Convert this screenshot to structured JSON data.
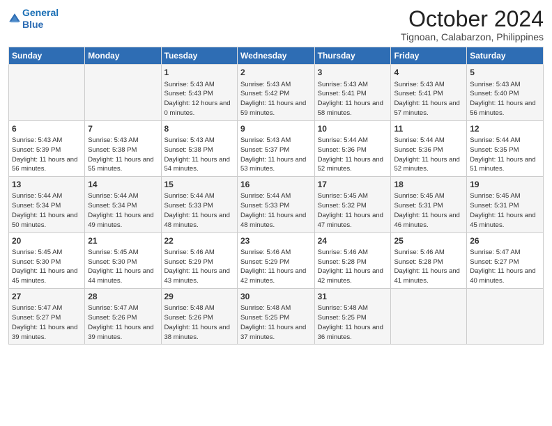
{
  "logo": {
    "line1": "General",
    "line2": "Blue"
  },
  "title": "October 2024",
  "location": "Tignoan, Calabarzon, Philippines",
  "days_of_week": [
    "Sunday",
    "Monday",
    "Tuesday",
    "Wednesday",
    "Thursday",
    "Friday",
    "Saturday"
  ],
  "weeks": [
    [
      {
        "day": "",
        "sunrise": "",
        "sunset": "",
        "daylight": ""
      },
      {
        "day": "",
        "sunrise": "",
        "sunset": "",
        "daylight": ""
      },
      {
        "day": "1",
        "sunrise": "Sunrise: 5:43 AM",
        "sunset": "Sunset: 5:43 PM",
        "daylight": "Daylight: 12 hours and 0 minutes."
      },
      {
        "day": "2",
        "sunrise": "Sunrise: 5:43 AM",
        "sunset": "Sunset: 5:42 PM",
        "daylight": "Daylight: 11 hours and 59 minutes."
      },
      {
        "day": "3",
        "sunrise": "Sunrise: 5:43 AM",
        "sunset": "Sunset: 5:41 PM",
        "daylight": "Daylight: 11 hours and 58 minutes."
      },
      {
        "day": "4",
        "sunrise": "Sunrise: 5:43 AM",
        "sunset": "Sunset: 5:41 PM",
        "daylight": "Daylight: 11 hours and 57 minutes."
      },
      {
        "day": "5",
        "sunrise": "Sunrise: 5:43 AM",
        "sunset": "Sunset: 5:40 PM",
        "daylight": "Daylight: 11 hours and 56 minutes."
      }
    ],
    [
      {
        "day": "6",
        "sunrise": "Sunrise: 5:43 AM",
        "sunset": "Sunset: 5:39 PM",
        "daylight": "Daylight: 11 hours and 56 minutes."
      },
      {
        "day": "7",
        "sunrise": "Sunrise: 5:43 AM",
        "sunset": "Sunset: 5:38 PM",
        "daylight": "Daylight: 11 hours and 55 minutes."
      },
      {
        "day": "8",
        "sunrise": "Sunrise: 5:43 AM",
        "sunset": "Sunset: 5:38 PM",
        "daylight": "Daylight: 11 hours and 54 minutes."
      },
      {
        "day": "9",
        "sunrise": "Sunrise: 5:43 AM",
        "sunset": "Sunset: 5:37 PM",
        "daylight": "Daylight: 11 hours and 53 minutes."
      },
      {
        "day": "10",
        "sunrise": "Sunrise: 5:44 AM",
        "sunset": "Sunset: 5:36 PM",
        "daylight": "Daylight: 11 hours and 52 minutes."
      },
      {
        "day": "11",
        "sunrise": "Sunrise: 5:44 AM",
        "sunset": "Sunset: 5:36 PM",
        "daylight": "Daylight: 11 hours and 52 minutes."
      },
      {
        "day": "12",
        "sunrise": "Sunrise: 5:44 AM",
        "sunset": "Sunset: 5:35 PM",
        "daylight": "Daylight: 11 hours and 51 minutes."
      }
    ],
    [
      {
        "day": "13",
        "sunrise": "Sunrise: 5:44 AM",
        "sunset": "Sunset: 5:34 PM",
        "daylight": "Daylight: 11 hours and 50 minutes."
      },
      {
        "day": "14",
        "sunrise": "Sunrise: 5:44 AM",
        "sunset": "Sunset: 5:34 PM",
        "daylight": "Daylight: 11 hours and 49 minutes."
      },
      {
        "day": "15",
        "sunrise": "Sunrise: 5:44 AM",
        "sunset": "Sunset: 5:33 PM",
        "daylight": "Daylight: 11 hours and 48 minutes."
      },
      {
        "day": "16",
        "sunrise": "Sunrise: 5:44 AM",
        "sunset": "Sunset: 5:33 PM",
        "daylight": "Daylight: 11 hours and 48 minutes."
      },
      {
        "day": "17",
        "sunrise": "Sunrise: 5:45 AM",
        "sunset": "Sunset: 5:32 PM",
        "daylight": "Daylight: 11 hours and 47 minutes."
      },
      {
        "day": "18",
        "sunrise": "Sunrise: 5:45 AM",
        "sunset": "Sunset: 5:31 PM",
        "daylight": "Daylight: 11 hours and 46 minutes."
      },
      {
        "day": "19",
        "sunrise": "Sunrise: 5:45 AM",
        "sunset": "Sunset: 5:31 PM",
        "daylight": "Daylight: 11 hours and 45 minutes."
      }
    ],
    [
      {
        "day": "20",
        "sunrise": "Sunrise: 5:45 AM",
        "sunset": "Sunset: 5:30 PM",
        "daylight": "Daylight: 11 hours and 45 minutes."
      },
      {
        "day": "21",
        "sunrise": "Sunrise: 5:45 AM",
        "sunset": "Sunset: 5:30 PM",
        "daylight": "Daylight: 11 hours and 44 minutes."
      },
      {
        "day": "22",
        "sunrise": "Sunrise: 5:46 AM",
        "sunset": "Sunset: 5:29 PM",
        "daylight": "Daylight: 11 hours and 43 minutes."
      },
      {
        "day": "23",
        "sunrise": "Sunrise: 5:46 AM",
        "sunset": "Sunset: 5:29 PM",
        "daylight": "Daylight: 11 hours and 42 minutes."
      },
      {
        "day": "24",
        "sunrise": "Sunrise: 5:46 AM",
        "sunset": "Sunset: 5:28 PM",
        "daylight": "Daylight: 11 hours and 42 minutes."
      },
      {
        "day": "25",
        "sunrise": "Sunrise: 5:46 AM",
        "sunset": "Sunset: 5:28 PM",
        "daylight": "Daylight: 11 hours and 41 minutes."
      },
      {
        "day": "26",
        "sunrise": "Sunrise: 5:47 AM",
        "sunset": "Sunset: 5:27 PM",
        "daylight": "Daylight: 11 hours and 40 minutes."
      }
    ],
    [
      {
        "day": "27",
        "sunrise": "Sunrise: 5:47 AM",
        "sunset": "Sunset: 5:27 PM",
        "daylight": "Daylight: 11 hours and 39 minutes."
      },
      {
        "day": "28",
        "sunrise": "Sunrise: 5:47 AM",
        "sunset": "Sunset: 5:26 PM",
        "daylight": "Daylight: 11 hours and 39 minutes."
      },
      {
        "day": "29",
        "sunrise": "Sunrise: 5:48 AM",
        "sunset": "Sunset: 5:26 PM",
        "daylight": "Daylight: 11 hours and 38 minutes."
      },
      {
        "day": "30",
        "sunrise": "Sunrise: 5:48 AM",
        "sunset": "Sunset: 5:25 PM",
        "daylight": "Daylight: 11 hours and 37 minutes."
      },
      {
        "day": "31",
        "sunrise": "Sunrise: 5:48 AM",
        "sunset": "Sunset: 5:25 PM",
        "daylight": "Daylight: 11 hours and 36 minutes."
      },
      {
        "day": "",
        "sunrise": "",
        "sunset": "",
        "daylight": ""
      },
      {
        "day": "",
        "sunrise": "",
        "sunset": "",
        "daylight": ""
      }
    ]
  ]
}
